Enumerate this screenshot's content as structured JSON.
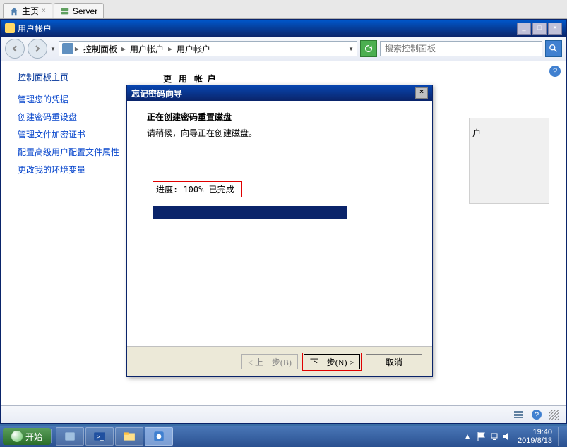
{
  "tabs": [
    {
      "label": "主页",
      "icon": "home-icon"
    },
    {
      "label": "Server",
      "icon": "server-icon"
    }
  ],
  "window": {
    "title": "用户帐户"
  },
  "breadcrumb": {
    "items": [
      "控制面板",
      "用户帐户",
      "用户帐户"
    ]
  },
  "search": {
    "placeholder": "搜索控制面板"
  },
  "sidebar": {
    "title": "控制面板主页",
    "links": [
      "管理您的凭据",
      "创建密码重设盘",
      "管理文件加密证书",
      "配置高级用户配置文件属性",
      "更改我的环境变量"
    ]
  },
  "obscured": {
    "partial_title": "更改用户帐户",
    "partial_text": "户"
  },
  "dialog": {
    "title": "忘记密码向导",
    "heading": "正在创建密码重置磁盘",
    "text": "请稍候，向导正在创建磁盘。",
    "progress_label": "进度: 100% 已完成",
    "buttons": {
      "back": "< 上一步(B)",
      "next": "下一步(N) >",
      "cancel": "取消"
    }
  },
  "taskbar": {
    "start": "开始"
  },
  "tray": {
    "time": "19:40",
    "date": "2019/8/13"
  }
}
